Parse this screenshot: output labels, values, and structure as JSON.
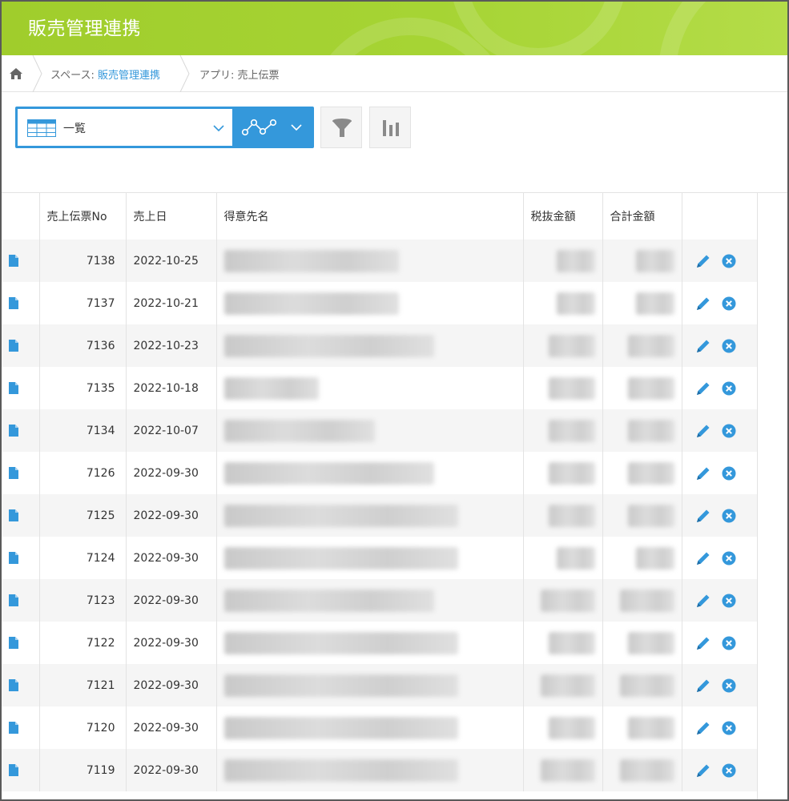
{
  "header": {
    "title": "販売管理連携"
  },
  "breadcrumb": {
    "space_label": "スペース: ",
    "space_name": "販売管理連携",
    "app_label": "アプリ: ",
    "app_name": "売上伝票"
  },
  "toolbar": {
    "view_name": "一覧"
  },
  "table": {
    "columns": [
      "売上伝票No",
      "売上日",
      "得意先名",
      "税抜金額",
      "合計金額"
    ],
    "rows": [
      {
        "no": "7138",
        "date": "2022-10-25"
      },
      {
        "no": "7137",
        "date": "2022-10-21"
      },
      {
        "no": "7136",
        "date": "2022-10-23"
      },
      {
        "no": "7135",
        "date": "2022-10-18"
      },
      {
        "no": "7134",
        "date": "2022-10-07"
      },
      {
        "no": "7126",
        "date": "2022-09-30"
      },
      {
        "no": "7125",
        "date": "2022-09-30"
      },
      {
        "no": "7124",
        "date": "2022-09-30"
      },
      {
        "no": "7123",
        "date": "2022-09-30"
      },
      {
        "no": "7122",
        "date": "2022-09-30"
      },
      {
        "no": "7121",
        "date": "2022-09-30"
      },
      {
        "no": "7120",
        "date": "2022-09-30"
      },
      {
        "no": "7119",
        "date": "2022-09-30"
      }
    ]
  },
  "colors": {
    "header_green": "#a6d434",
    "accent_blue": "#3498db"
  }
}
